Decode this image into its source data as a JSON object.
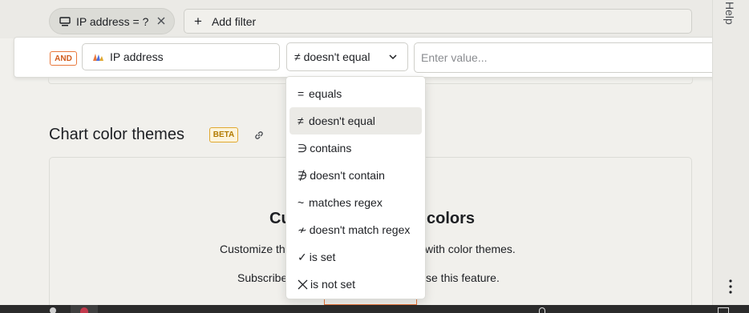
{
  "filter_bar": {
    "active_chip": "IP address = ?",
    "add_filter_label": "Add filter"
  },
  "editor": {
    "logic_badge": "AND",
    "property_label": "IP address",
    "operator_selected": "≠ doesn't equal",
    "value_placeholder": "Enter value..."
  },
  "operator_menu": {
    "items": [
      {
        "symbol": "=",
        "label": "equals"
      },
      {
        "symbol": "≠",
        "label": "doesn't equal"
      },
      {
        "symbol": "∋",
        "label": "contains"
      },
      {
        "symbol": "∌",
        "label": "doesn't contain"
      },
      {
        "symbol": "~",
        "label": "matches regex"
      },
      {
        "symbol": "≁",
        "label": "doesn't match regex"
      },
      {
        "symbol": "✓",
        "label": "is set"
      },
      {
        "symbol": "",
        "label": "is not set"
      }
    ],
    "active_index": 1
  },
  "section": {
    "title": "Chart color themes",
    "badge": "BETA"
  },
  "card": {
    "title_left": "Cu",
    "title_right": "colors",
    "desc_left": "Customize th",
    "desc_right": "with color themes.",
    "sub_left": "Subscribe",
    "sub_right": "se this feature."
  },
  "right_sidebar": {
    "help_label": "Help"
  },
  "colors": {
    "accent_orange": "#e9783c",
    "beta_yellow": "#e0a82f"
  }
}
